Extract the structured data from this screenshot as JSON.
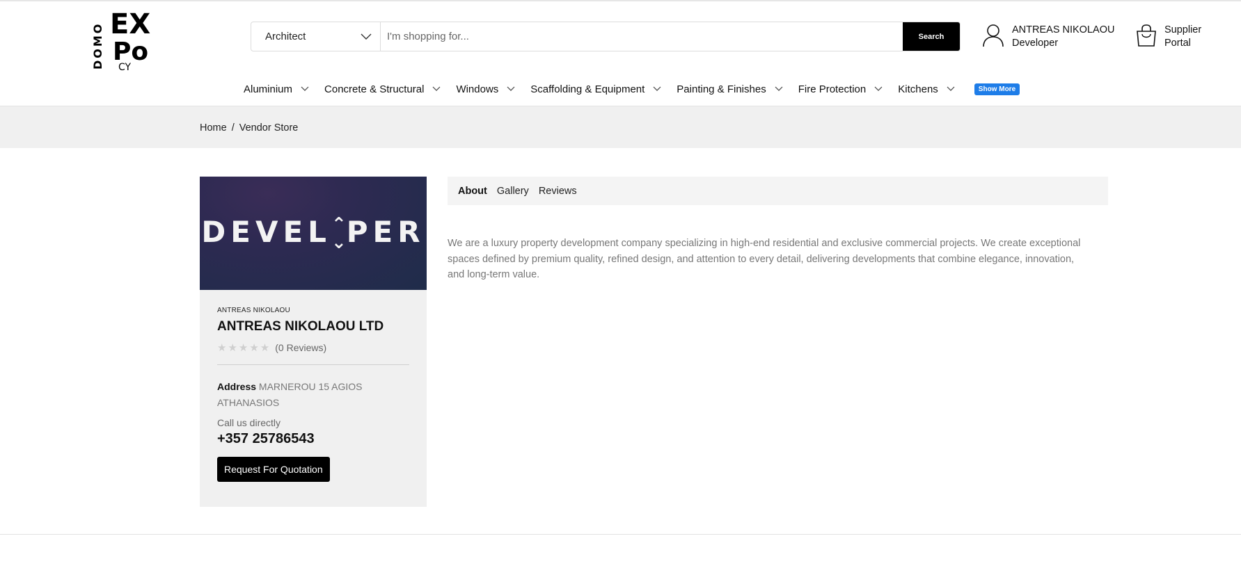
{
  "logo": {
    "letters": [
      "EX",
      "DOMO",
      "Po",
      "CY"
    ],
    "alt_text": "EXPO DOMO CY"
  },
  "search": {
    "category_value": "Architect",
    "placeholder": "I'm shopping for...",
    "button_label": "Search"
  },
  "user": {
    "name": "ANTREAS NIKOLAOU",
    "role": "Developer"
  },
  "supplier": {
    "line1": "Supplier",
    "line2": "Portal"
  },
  "nav": {
    "items": [
      {
        "label": "Aluminium"
      },
      {
        "label": "Concrete & Structural"
      },
      {
        "label": "Windows"
      },
      {
        "label": "Scaffolding & Equipment"
      },
      {
        "label": "Painting & Finishes"
      },
      {
        "label": "Fire Protection"
      },
      {
        "label": "Kitchens"
      }
    ],
    "show_more": "Show More",
    "accent_color": "#1e7de8"
  },
  "breadcrumb": {
    "home": "Home",
    "separator": "/",
    "current": "Vendor Store"
  },
  "vendor": {
    "banner_text": "DEVEL^VPER",
    "owner_small": "ANTREAS NIKOLAOU",
    "company": "ANTREAS NIKOLAOU LTD",
    "stars": "★★★★★",
    "rating": 0,
    "reviews_text": "(0 Reviews)",
    "address_label": "Address",
    "address_value": "MARNEROU 15 AGIOS ATHANASIOS",
    "call_label": "Call us directly",
    "phone": "+357 25786543",
    "rfq_label": "Request For Quotation"
  },
  "tabs": [
    {
      "label": "About",
      "active": true
    },
    {
      "label": "Gallery",
      "active": false
    },
    {
      "label": "Reviews",
      "active": false
    }
  ],
  "about_text": "We are a luxury property development company specializing in high-end residential and exclusive commercial projects. We create exceptional spaces defined by premium quality, refined design, and attention to every detail, delivering developments that combine elegance, innovation, and long-term value."
}
